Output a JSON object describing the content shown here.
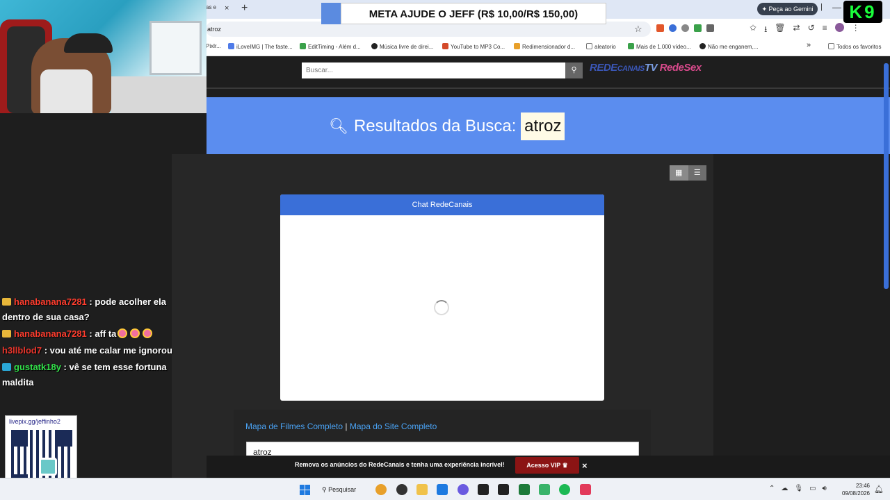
{
  "browser": {
    "tab_partial": "as e",
    "tab_close": "×",
    "new_tab": "+",
    "gemini_label": "✦ Peça ao Gemini",
    "url": "atroz",
    "bookmarks": [
      {
        "label": "Pixlr...",
        "color": "#2aa7d6"
      },
      {
        "label": "iLoveIMG | The faste...",
        "color": "#4f7be8"
      },
      {
        "label": "EditTiming - Além d...",
        "color": "#3aa14a"
      },
      {
        "label": "Música livre de direi...",
        "color": "#222222"
      },
      {
        "label": "YouTube to MP3 Co...",
        "color": "#d44a2a"
      },
      {
        "label": "Redimensionador d...",
        "color": "#e8a02a"
      },
      {
        "label": "aleatorio",
        "color": "#777777"
      },
      {
        "label": "Mais de 1.000 vídeo...",
        "color": "#3aa14a"
      },
      {
        "label": "Não me enganem,...",
        "color": "#222222"
      }
    ],
    "bookmarks_overflow": "»",
    "all_favorites": "Todos os favoritos"
  },
  "stream": {
    "banner": "META AJUDE O JEFF (R$ 10,00/R$ 150,00)",
    "logo_k9": "K9",
    "chat": [
      {
        "user": "hanabanana7281",
        "message": ": pode acolher ela dentro de sua casa?",
        "badge_color": "#e8b73a",
        "user_class": "user-red"
      },
      {
        "user": "hanabanana7281",
        "message": ": aff ta",
        "badge_color": "#e8b73a",
        "user_class": "user-red",
        "emotes": 3
      },
      {
        "user": "h3llblod7",
        "message": ": vou até me calar me ignorou",
        "badge_color": "",
        "user_class": "user-red2"
      },
      {
        "user": "gustatk18y",
        "message": ": vê se tem esse fortuna maldita",
        "badge_color": "#2aa7d6",
        "user_class": "user-green"
      }
    ],
    "qr_label": "livepix.gg/jeffinho2"
  },
  "site": {
    "search_placeholder": "Buscar...",
    "search_icon": "search-icon",
    "logo_text_a": "REDE",
    "logo_text_b": "CANAIS",
    "logo_text_tv": "TV",
    "logo_text_x": "RedeSex",
    "hero_label": "Resultados da Busca:",
    "hero_query": "atroz",
    "chat_title": "Chat RedeCanais",
    "link_map_movies": "Mapa de Filmes Completo",
    "link_separator": "|",
    "link_map_site": "Mapa do Site Completo",
    "bottom_input_value": "atroz",
    "vip_text": "Remova os anúncios do RedeCanais e tenha uma experiência incrível!",
    "vip_button": "Acesso VIP",
    "vip_close": "×"
  },
  "taskbar": {
    "search_label": "Pesquisar",
    "time": "23:46",
    "date": "09/08/2026"
  }
}
